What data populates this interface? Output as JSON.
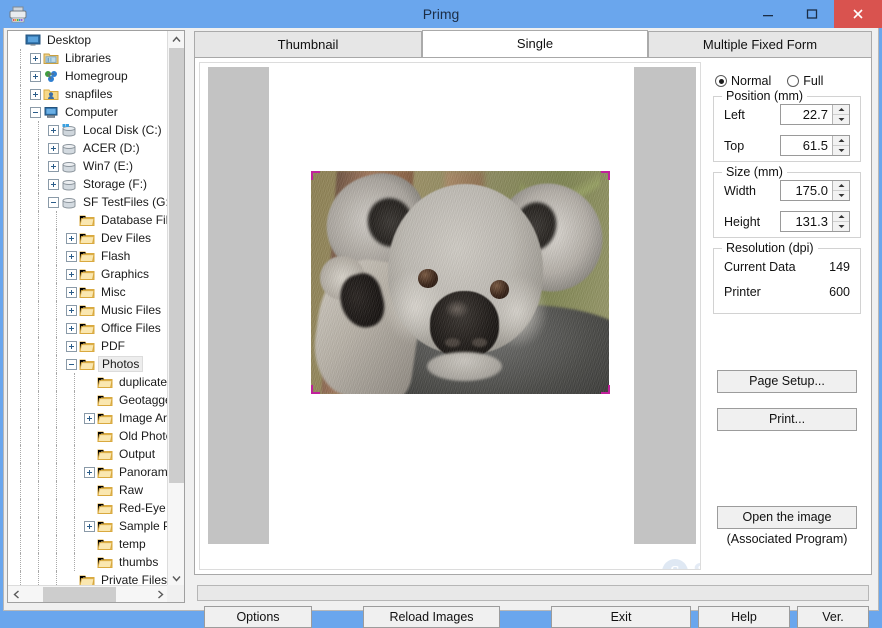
{
  "window": {
    "title": "Primg",
    "app_icon": "printer-icon",
    "minimize_label": "Minimize",
    "maximize_label": "Maximize",
    "close_label": "Close",
    "close_color": "#d9534f",
    "titlebar_color": "#6aa6ed"
  },
  "tabs": [
    {
      "label": "Thumbnail",
      "active": false
    },
    {
      "label": "Single",
      "active": true
    },
    {
      "label": "Multiple Fixed Form",
      "active": false
    }
  ],
  "tree": {
    "items": [
      {
        "label": "Desktop",
        "depth": 0,
        "expander": "none",
        "icon": "desktop-icon",
        "selected": false
      },
      {
        "label": "Libraries",
        "depth": 1,
        "expander": "plus",
        "icon": "library-icon",
        "selected": false
      },
      {
        "label": "Homegroup",
        "depth": 1,
        "expander": "plus",
        "icon": "homegroup-icon",
        "selected": false
      },
      {
        "label": "snapfiles",
        "depth": 1,
        "expander": "plus",
        "icon": "user-icon",
        "selected": false
      },
      {
        "label": "Computer",
        "depth": 1,
        "expander": "minus",
        "icon": "computer-icon",
        "selected": false
      },
      {
        "label": "Local Disk (C:)",
        "depth": 2,
        "expander": "plus",
        "icon": "harddisk-icon",
        "selected": false
      },
      {
        "label": "ACER (D:)",
        "depth": 2,
        "expander": "plus",
        "icon": "drive-icon",
        "selected": false
      },
      {
        "label": "Win7 (E:)",
        "depth": 2,
        "expander": "plus",
        "icon": "drive-icon",
        "selected": false
      },
      {
        "label": "Storage (F:)",
        "depth": 2,
        "expander": "plus",
        "icon": "drive-icon",
        "selected": false
      },
      {
        "label": "SF TestFiles (G:)",
        "depth": 2,
        "expander": "minus",
        "icon": "drive-icon",
        "selected": false
      },
      {
        "label": "Database Files",
        "depth": 3,
        "expander": "none",
        "icon": "folder-icon",
        "selected": false
      },
      {
        "label": "Dev Files",
        "depth": 3,
        "expander": "plus",
        "icon": "folder-icon",
        "selected": false
      },
      {
        "label": "Flash",
        "depth": 3,
        "expander": "plus",
        "icon": "folder-icon",
        "selected": false
      },
      {
        "label": "Graphics",
        "depth": 3,
        "expander": "plus",
        "icon": "folder-icon",
        "selected": false
      },
      {
        "label": "Misc",
        "depth": 3,
        "expander": "plus",
        "icon": "folder-icon",
        "selected": false
      },
      {
        "label": "Music Files",
        "depth": 3,
        "expander": "plus",
        "icon": "folder-icon",
        "selected": false
      },
      {
        "label": "Office Files",
        "depth": 3,
        "expander": "plus",
        "icon": "folder-icon",
        "selected": false
      },
      {
        "label": "PDF",
        "depth": 3,
        "expander": "plus",
        "icon": "folder-icon",
        "selected": false
      },
      {
        "label": "Photos",
        "depth": 3,
        "expander": "minus",
        "icon": "folder-icon",
        "selected": true
      },
      {
        "label": "duplicates",
        "depth": 4,
        "expander": "none",
        "icon": "folder-icon",
        "selected": false
      },
      {
        "label": "Geotagged",
        "depth": 4,
        "expander": "none",
        "icon": "folder-icon",
        "selected": false
      },
      {
        "label": "Image Arch",
        "depth": 4,
        "expander": "plus",
        "icon": "folder-icon",
        "selected": false
      },
      {
        "label": "Old Photos",
        "depth": 4,
        "expander": "none",
        "icon": "folder-icon",
        "selected": false
      },
      {
        "label": "Output",
        "depth": 4,
        "expander": "none",
        "icon": "folder-icon",
        "selected": false
      },
      {
        "label": "Panoramas",
        "depth": 4,
        "expander": "plus",
        "icon": "folder-icon",
        "selected": false
      },
      {
        "label": "Raw",
        "depth": 4,
        "expander": "none",
        "icon": "folder-icon",
        "selected": false
      },
      {
        "label": "Red-Eye",
        "depth": 4,
        "expander": "none",
        "icon": "folder-icon",
        "selected": false
      },
      {
        "label": "Sample Pict",
        "depth": 4,
        "expander": "plus",
        "icon": "folder-icon",
        "selected": false
      },
      {
        "label": "temp",
        "depth": 4,
        "expander": "none",
        "icon": "folder-icon",
        "selected": false
      },
      {
        "label": "thumbs",
        "depth": 4,
        "expander": "none",
        "icon": "folder-icon",
        "selected": false
      },
      {
        "label": "Private Files",
        "depth": 3,
        "expander": "none",
        "icon": "folder-icon",
        "selected": false
      }
    ],
    "vscroll_icon_up": "chevron-up-icon",
    "vscroll_icon_down": "chevron-down-icon",
    "hscroll_icon_left": "chevron-left-icon",
    "hscroll_icon_right": "chevron-right-icon"
  },
  "preview": {
    "image_subject": "koala",
    "selection_handle_color": "#c0219a",
    "page_background": "#ffffff",
    "margin_background": "#c3c3c3",
    "watermark_text": "SnapFiles",
    "watermark_badge": "S"
  },
  "options_panel": {
    "mode": {
      "normal_label": "Normal",
      "full_label": "Full",
      "selected": "Normal"
    },
    "position": {
      "title": "Position (mm)",
      "left_label": "Left",
      "left_value": "22.7",
      "top_label": "Top",
      "top_value": "61.5"
    },
    "size": {
      "title": "Size (mm)",
      "width_label": "Width",
      "width_value": "175.0",
      "height_label": "Height",
      "height_value": "131.3"
    },
    "resolution": {
      "title": "Resolution (dpi)",
      "current_data_label": "Current Data",
      "current_data_value": "149",
      "printer_label": "Printer",
      "printer_value": "600"
    },
    "buttons": {
      "page_setup": "Page Setup...",
      "print": "Print...",
      "open_image": "Open the image",
      "associated_note": "(Associated Program)"
    }
  },
  "statusbar": {
    "text": ""
  },
  "bottom_buttons": [
    {
      "label": "Options"
    },
    {
      "label": "Reload Images"
    },
    {
      "label": "Exit"
    },
    {
      "label": "Help"
    },
    {
      "label": "Ver."
    }
  ]
}
